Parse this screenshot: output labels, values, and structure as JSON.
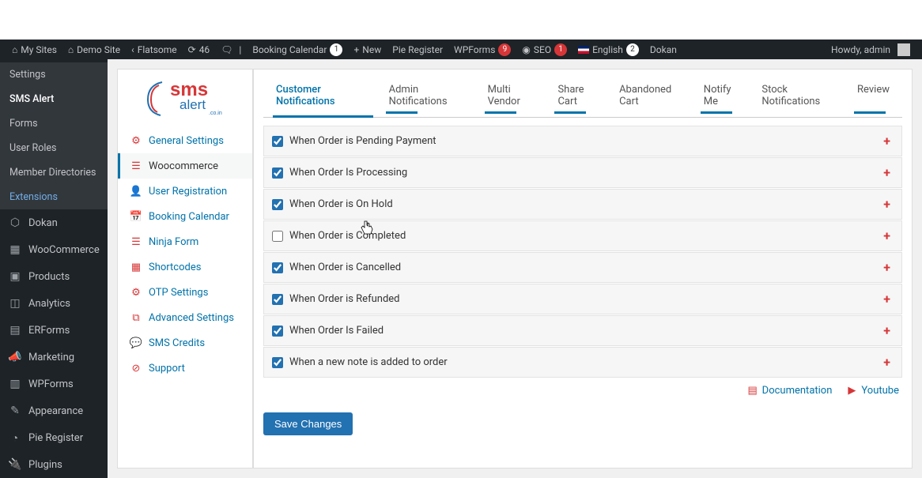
{
  "adminbar": {
    "my_sites": "My Sites",
    "demo_site": "Demo Site",
    "flatsome": "Flatsome",
    "updates": "46",
    "comments": "",
    "booking_calendar": "Booking Calendar",
    "booking_count": "1",
    "new": "New",
    "pie_register": "Pie Register",
    "wpforms": "WPForms",
    "wpforms_count": "9",
    "seo": "SEO",
    "seo_count": "1",
    "lang": "English",
    "lang_count": "2",
    "dokan": "Dokan",
    "howdy": "Howdy, admin"
  },
  "sidebar": {
    "pre": [
      {
        "label": "Settings"
      },
      {
        "label": "SMS Alert",
        "current": true
      },
      {
        "label": "Forms"
      },
      {
        "label": "User Roles"
      },
      {
        "label": "Member Directories"
      },
      {
        "label": "Extensions",
        "active": true
      }
    ],
    "items": [
      {
        "icon": "⬡",
        "label": "Dokan"
      },
      {
        "icon": "▦",
        "label": "WooCommerce"
      },
      {
        "icon": "▣",
        "label": "Products"
      },
      {
        "icon": "◫",
        "label": "Analytics"
      },
      {
        "icon": "▤",
        "label": "ERForms"
      },
      {
        "icon": "📣",
        "label": "Marketing"
      },
      {
        "icon": "▥",
        "label": "WPForms"
      },
      {
        "icon": "✎",
        "label": "Appearance"
      },
      {
        "icon": "◔",
        "label": "Pie Register"
      },
      {
        "icon": "🔌",
        "label": "Plugins"
      }
    ]
  },
  "innerSidebar": {
    "logo_t1": "sms",
    "logo_t2": "alert",
    "links": [
      {
        "icon": "⚙",
        "label": "General Settings",
        "name": "general-settings"
      },
      {
        "icon": "☰",
        "label": "Woocommerce",
        "selected": true,
        "name": "woocommerce"
      },
      {
        "icon": "👤",
        "label": "User Registration",
        "name": "user-registration"
      },
      {
        "icon": "📅",
        "label": "Booking Calendar",
        "name": "booking-calendar"
      },
      {
        "icon": "☰",
        "label": "Ninja Form",
        "name": "ninja-form"
      },
      {
        "icon": "▦",
        "label": "Shortcodes",
        "name": "shortcodes"
      },
      {
        "icon": "⚙",
        "label": "OTP Settings",
        "name": "otp-settings"
      },
      {
        "icon": "⧉",
        "label": "Advanced Settings",
        "name": "advanced-settings"
      },
      {
        "icon": "💬",
        "label": "SMS Credits",
        "name": "sms-credits"
      },
      {
        "icon": "⊘",
        "label": "Support",
        "name": "support"
      }
    ]
  },
  "tabs": [
    {
      "label": "Customer Notifications",
      "active": true
    },
    {
      "label": "Admin Notifications",
      "underlined": true
    },
    {
      "label": "Multi Vendor",
      "underlined": true
    },
    {
      "label": "Share Cart",
      "underlined": true
    },
    {
      "label": "Abandoned Cart"
    },
    {
      "label": "Notify Me",
      "underlined": true
    },
    {
      "label": "Stock Notifications"
    },
    {
      "label": "Review",
      "underlined": true
    }
  ],
  "notifications": [
    {
      "label": "When Order is Pending Payment",
      "checked": true
    },
    {
      "label": "When Order Is Processing",
      "checked": true
    },
    {
      "label": "When Order is On Hold",
      "checked": true
    },
    {
      "label": "When Order is Completed",
      "checked": false
    },
    {
      "label": "When Order is Cancelled",
      "checked": true
    },
    {
      "label": "When Order is Refunded",
      "checked": true
    },
    {
      "label": "When Order Is Failed",
      "checked": true
    },
    {
      "label": "When a new note is added to order",
      "checked": true
    }
  ],
  "footer": {
    "doc": "Documentation",
    "yt": "Youtube"
  },
  "save_label": "Save Changes",
  "colors": {
    "accent": "#2271b1",
    "danger": "#d63638"
  }
}
